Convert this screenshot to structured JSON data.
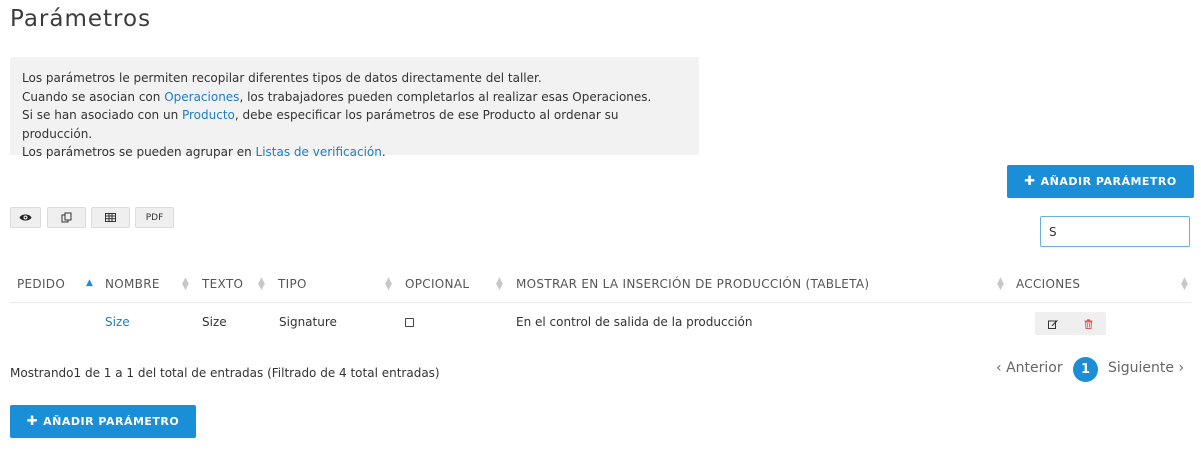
{
  "page": {
    "title": "Parámetros"
  },
  "info": {
    "line1": "Los parámetros le permiten recopilar diferentes tipos de datos directamente del taller.",
    "line2_pre": "Cuando se asocian con ",
    "line2_link": "Operaciones",
    "line2_post": ", los trabajadores pueden completarlos al realizar esas Operaciones.",
    "line3_pre": "Si se han asociado con un ",
    "line3_link": "Producto",
    "line3_post": ", debe especificar los parámetros de ese Producto al ordenar su producción.",
    "line4_pre": "Los parámetros se pueden agrupar en ",
    "line4_link": "Listas de verificación",
    "line4_post": "."
  },
  "buttons": {
    "add_parameter_top": "AÑADIR PARÁMETRO",
    "add_parameter_bottom": "AÑADIR PARÁMETRO",
    "plus_glyph": "✚"
  },
  "toolbar": {
    "view_icon": "eye-icon",
    "copy_icon": "copy-icon",
    "table_icon": "table-icon",
    "pdf_label": "PDF"
  },
  "search": {
    "value": "S"
  },
  "table": {
    "headers": {
      "order": "PEDIDO",
      "name": "NOMBRE",
      "text": "TEXTO",
      "type": "TIPO",
      "optional": "OPCIONAL",
      "show": "MOSTRAR EN LA INSERCIÓN DE PRODUCCIÓN (TABLETA)",
      "actions": "ACCIONES"
    },
    "rows": [
      {
        "order": "",
        "name": "Size",
        "text": "Size",
        "type": "Signature",
        "optional": false,
        "show": "En el control de salida de la producción"
      }
    ]
  },
  "footer": {
    "summary": "Mostrando1 de 1 a 1 del total de entradas (Filtrado de 4 total entradas)",
    "prev": "Anterior",
    "next": "Siguiente",
    "current_page": "1"
  },
  "colors": {
    "accent": "#1a8ed6",
    "link": "#1e7ec0",
    "delete": "#e05a5a"
  }
}
